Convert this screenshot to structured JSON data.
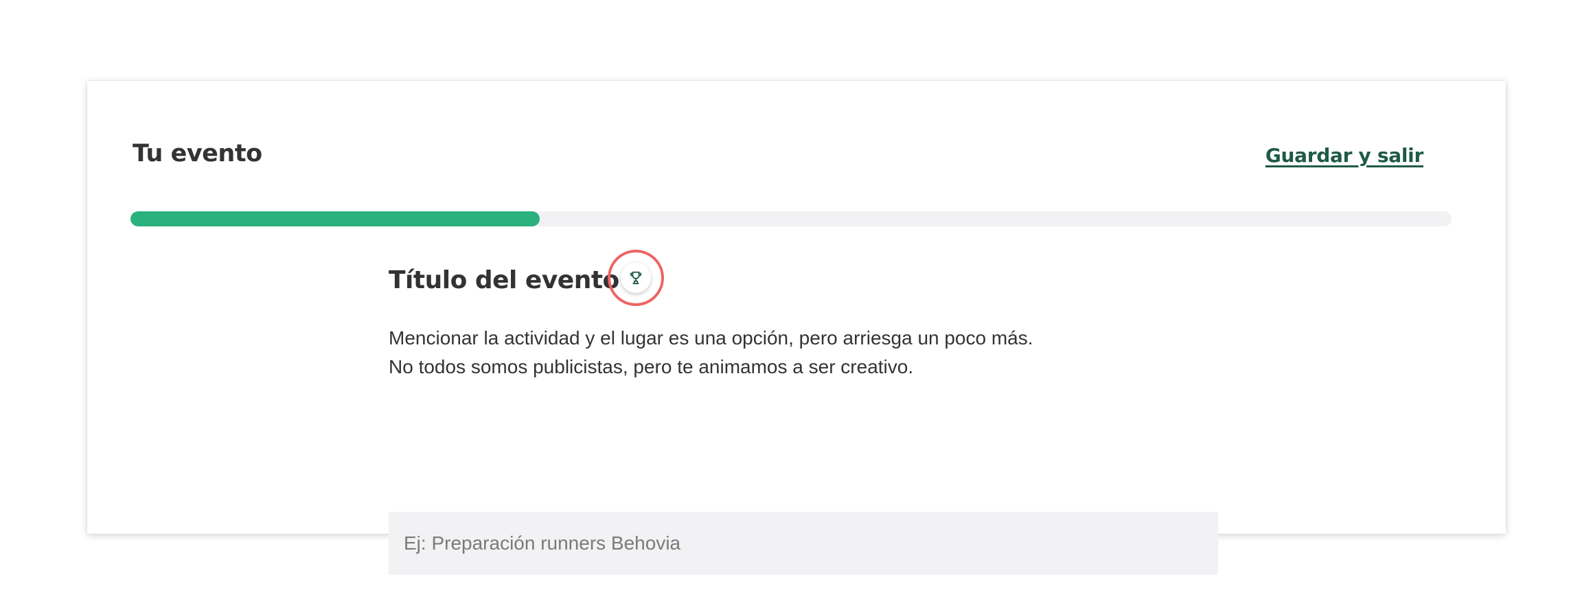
{
  "header": {
    "title": "Tu evento",
    "save_exit_label": "Guardar y salir"
  },
  "progress": {
    "value": 0.31,
    "track_color": "#f2f1f3",
    "fill_color": "#2bb17e"
  },
  "section": {
    "title": "Título del evento",
    "icon": "trophy-icon",
    "description_lines": [
      "Mencionar la actividad y el lugar es una opción, pero arriesga un poco más.",
      "No todos somos publicistas, pero te animamos a ser creativo."
    ],
    "input": {
      "value": "",
      "placeholder": "Ej: Preparación runners Behovia"
    }
  },
  "colors": {
    "accent": "#2bb17e",
    "link": "#1f5a44",
    "highlight_ring": "#ee6363"
  }
}
